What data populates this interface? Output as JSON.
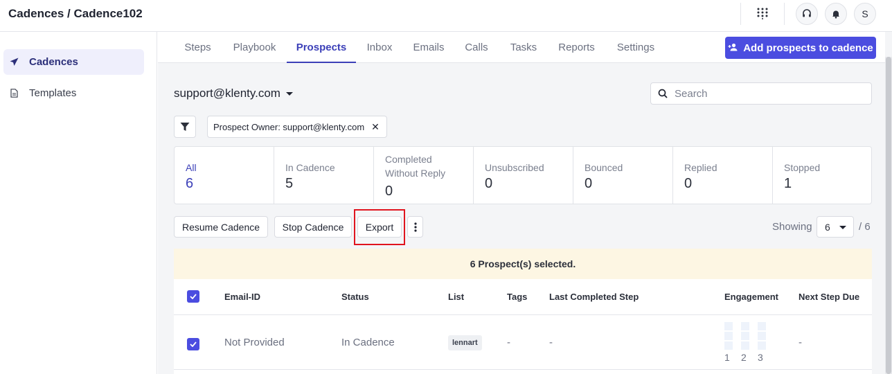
{
  "header": {
    "title": "Cadences / Cadence102",
    "avatar_initial": "S"
  },
  "sidebar": {
    "items": [
      {
        "label": "Cadences",
        "icon": "paper-plane-icon",
        "active": true
      },
      {
        "label": "Templates",
        "icon": "document-icon",
        "active": false
      }
    ]
  },
  "tabs": [
    {
      "label": "Steps"
    },
    {
      "label": "Playbook"
    },
    {
      "label": "Prospects",
      "active": true
    },
    {
      "label": "Inbox"
    },
    {
      "label": "Emails"
    },
    {
      "label": "Calls"
    },
    {
      "label": "Tasks"
    },
    {
      "label": "Reports"
    },
    {
      "label": "Settings"
    }
  ],
  "add_button_label": "Add prospects to cadence",
  "owner_select": "support@klenty.com",
  "search": {
    "placeholder": "Search",
    "value": ""
  },
  "filter_chip": "Prospect Owner: support@klenty.com",
  "stats": [
    {
      "label": "All",
      "value": "6",
      "active": true
    },
    {
      "label": "In Cadence",
      "value": "5"
    },
    {
      "label": "Completed Without Reply",
      "value": "0"
    },
    {
      "label": "Unsubscribed",
      "value": "0"
    },
    {
      "label": "Bounced",
      "value": "0"
    },
    {
      "label": "Replied",
      "value": "0"
    },
    {
      "label": "Stopped",
      "value": "1"
    }
  ],
  "actions": {
    "resume": "Resume Cadence",
    "stop": "Stop Cadence",
    "export": "Export"
  },
  "pagination": {
    "showing_label": "Showing",
    "page_size": "6",
    "total": "/ 6"
  },
  "selected_banner": "6 Prospect(s) selected.",
  "table": {
    "columns": [
      "Email-ID",
      "Status",
      "List",
      "Tags",
      "Last Completed Step",
      "Engagement",
      "Next Step Due"
    ],
    "rows": [
      {
        "email": "Not Provided",
        "status": "In Cadence",
        "list": "lennart",
        "tags": "-",
        "last_step": "-",
        "engagement": [
          "1",
          "2",
          "3"
        ],
        "next_due": "-"
      }
    ]
  },
  "colors": {
    "accent": "#4b4de0",
    "active_text": "#3b3fb8",
    "banner_bg": "#fdf6e3",
    "highlight": "#e0141e"
  }
}
